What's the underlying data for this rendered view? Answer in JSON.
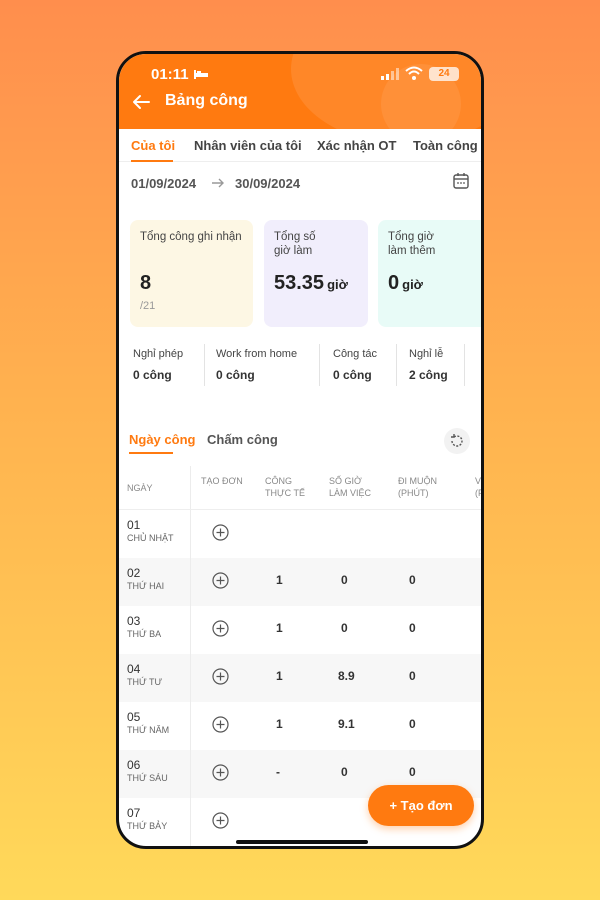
{
  "status_bar": {
    "time": "01:11",
    "battery": "24"
  },
  "header": {
    "title": "Bảng công"
  },
  "tabs": [
    {
      "label": "Của tôi",
      "active": true
    },
    {
      "label": "Nhân viên của tôi",
      "active": false
    },
    {
      "label": "Xác nhận OT",
      "active": false
    },
    {
      "label": "Toàn công ty",
      "active": false
    }
  ],
  "date_range": {
    "from": "01/09/2024",
    "to": "30/09/2024"
  },
  "summary_cards": [
    {
      "label": "Tổng công ghi nhận",
      "value": "8",
      "unit": "",
      "sub": "/21"
    },
    {
      "label": "Tổng số\ngiờ làm",
      "value": "53.35",
      "unit": "giờ",
      "sub": ""
    },
    {
      "label": "Tổng giờ\nlàm thêm",
      "value": "0",
      "unit": "giờ",
      "sub": ""
    }
  ],
  "stats": [
    {
      "label": "Nghỉ phép",
      "value": "0 công"
    },
    {
      "label": "Work from home",
      "value": "0 công"
    },
    {
      "label": "Công tác",
      "value": "0 công"
    },
    {
      "label": "Nghỉ lễ",
      "value": "2 công"
    }
  ],
  "sub_tabs": [
    {
      "label": "Ngày công",
      "active": true
    },
    {
      "label": "Chấm công",
      "active": false
    }
  ],
  "table": {
    "headers": [
      "NGÀY",
      "TẠO ĐƠN",
      "CÔNG\nTHỰC TẾ",
      "SỐ GIỜ\nLÀM VIỆC",
      "ĐI MUỘN\n(PHÚT)",
      "V\n(P"
    ],
    "rows": [
      {
        "day": "01",
        "weekday": "CHỦ NHẬT",
        "cong": "",
        "gio": "",
        "muon": ""
      },
      {
        "day": "02",
        "weekday": "THỨ HAI",
        "cong": "1",
        "gio": "0",
        "muon": "0"
      },
      {
        "day": "03",
        "weekday": "THỨ BA",
        "cong": "1",
        "gio": "0",
        "muon": "0"
      },
      {
        "day": "04",
        "weekday": "THỨ TƯ",
        "cong": "1",
        "gio": "8.9",
        "muon": "0"
      },
      {
        "day": "05",
        "weekday": "THỨ NĂM",
        "cong": "1",
        "gio": "9.1",
        "muon": "0"
      },
      {
        "day": "06",
        "weekday": "THỨ SÁU",
        "cong": "-",
        "gio": "0",
        "muon": "0"
      },
      {
        "day": "07",
        "weekday": "THỨ BẢY",
        "cong": "",
        "gio": "",
        "muon": ""
      }
    ]
  },
  "fab": {
    "label": "+ Tạo đơn"
  },
  "colors": {
    "accent": "#ff7a10",
    "card1": "#fdf7e4",
    "card2": "#f1eefc",
    "card3": "#e8fbf7"
  }
}
